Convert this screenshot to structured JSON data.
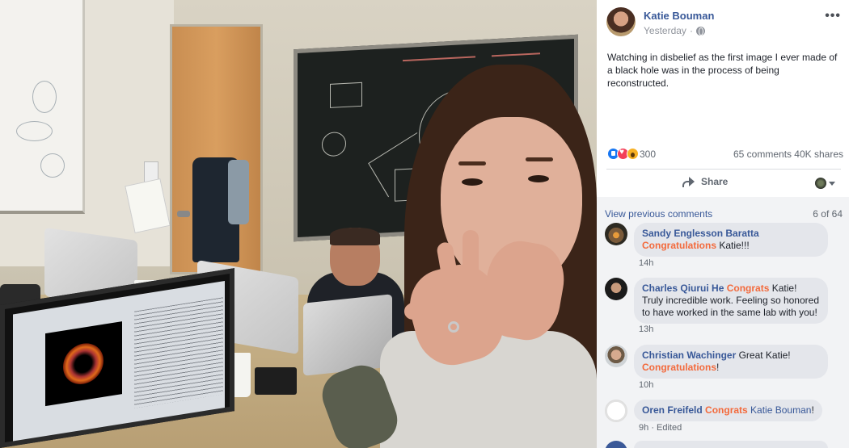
{
  "post": {
    "author": "Katie Bouman",
    "time": "Yesterday",
    "separator": "·",
    "more_glyph": "•••",
    "text": "Watching in disbelief as the first image I ever made of a black hole was in the process of being reconstructed."
  },
  "stats": {
    "reaction_count": "300",
    "comments": "65 comments",
    "shares": "40K shares"
  },
  "actions": {
    "share_label": "Share"
  },
  "comments_section": {
    "view_previous": "View previous comments",
    "pager": "6 of 64",
    "items": [
      {
        "name": "Sandy Englesson Baratta",
        "tag": "Congratulations",
        "text": " Katie!!!",
        "time": "14h"
      },
      {
        "name": "Charles Qiurui He",
        "tag": "Congrats",
        "text": " Katie! Truly incredible work. Feeling so honored to have worked in the same lab with you!",
        "time": "13h"
      },
      {
        "name": "Christian Wachinger",
        "text_pre": " Great Katie!",
        "tag": "Congratulations",
        "text": "!",
        "time": "10h"
      },
      {
        "name": "Oren Freifeld",
        "tag": "Congrats",
        "mention": "Katie Bouman",
        "text": "!",
        "time": "9h",
        "edited": "· Edited"
      }
    ]
  },
  "colors": {
    "link": "#385898",
    "tag": "#f36a3c",
    "comment_bubble": "#e4e6eb",
    "comments_bg": "#f2f3f5"
  },
  "icons": [
    "globe-icon",
    "more-icon",
    "like-reaction-icon",
    "love-reaction-icon",
    "wow-reaction-icon",
    "share-icon",
    "chevron-down-icon"
  ]
}
